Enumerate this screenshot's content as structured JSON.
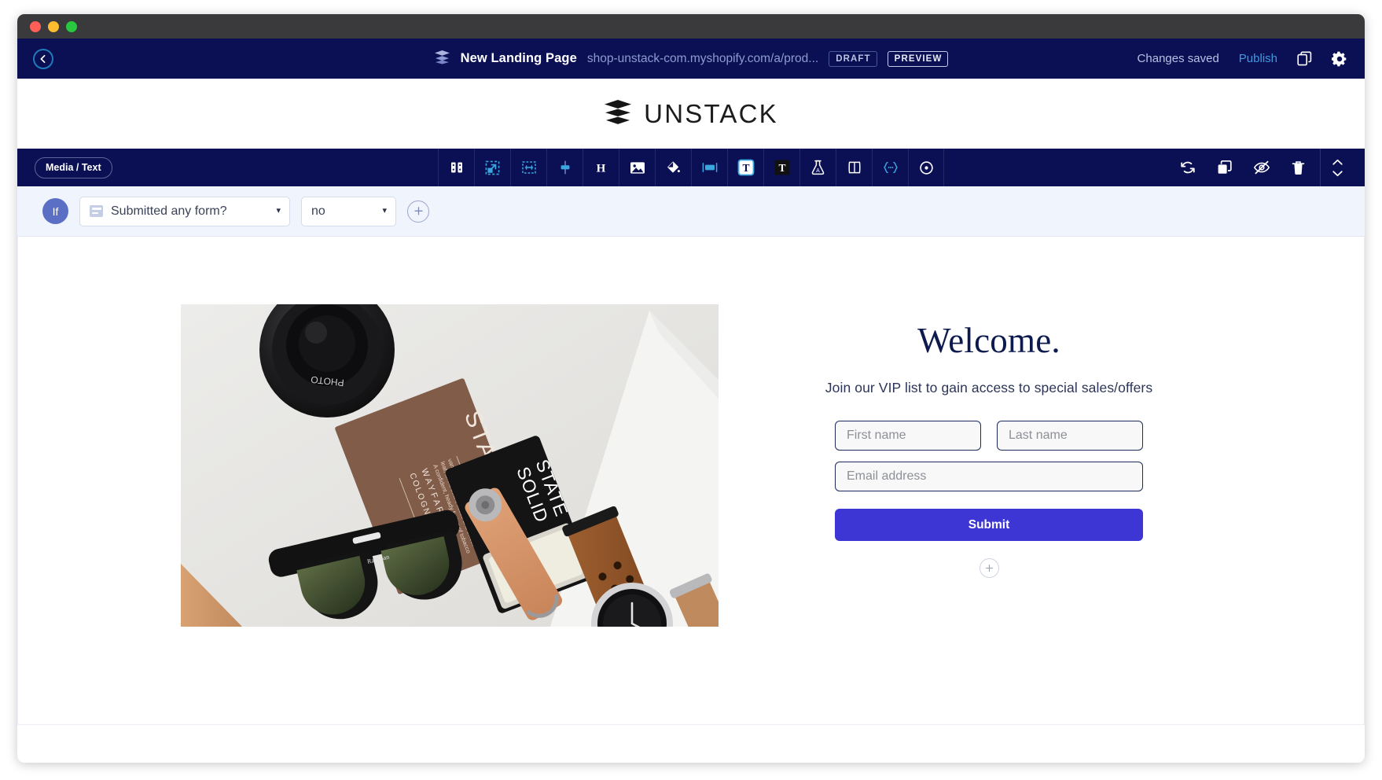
{
  "window": {
    "lights": [
      "close",
      "minimize",
      "zoom"
    ]
  },
  "appbar": {
    "back_icon": "chevron-left-icon",
    "brand_icon": "stack-layers-icon",
    "title": "New Landing Page",
    "url": "shop-unstack-com.myshopify.com/a/prod...",
    "status_badge": "DRAFT",
    "preview_badge": "PREVIEW",
    "save_status": "Changes saved",
    "publish_label": "Publish",
    "duplicate_icon": "copy-icon",
    "settings_icon": "gear-icon",
    "background": "#0b1054",
    "link_color": "#3f9ae0"
  },
  "brandbar": {
    "logo_icon": "stack-layers-icon",
    "wordmark": "UNSTACK"
  },
  "toolbar": {
    "block_chip": "Media / Text",
    "tools": [
      {
        "name": "layout-columns-icon",
        "glyph": "columns",
        "accent": false
      },
      {
        "name": "resize-section-icon",
        "glyph": "resize",
        "accent": true
      },
      {
        "name": "spacing-width-icon",
        "glyph": "width",
        "accent": true
      },
      {
        "name": "vertical-align-icon",
        "glyph": "valign",
        "accent": true
      },
      {
        "name": "heading-icon",
        "glyph": "H",
        "accent": false
      },
      {
        "name": "image-icon",
        "glyph": "image",
        "accent": false
      },
      {
        "name": "background-fill-icon",
        "glyph": "fill",
        "accent": false
      },
      {
        "name": "button-icon",
        "glyph": "button",
        "accent": true
      },
      {
        "name": "text-color-light-icon",
        "glyph": "T-light",
        "accent": false
      },
      {
        "name": "text-color-dark-icon",
        "glyph": "T-dark",
        "accent": false
      },
      {
        "name": "ab-test-icon",
        "glyph": "flask",
        "accent": false
      },
      {
        "name": "container-width-icon",
        "glyph": "container",
        "accent": false
      },
      {
        "name": "embed-code-icon",
        "glyph": "braces",
        "accent": true
      },
      {
        "name": "target-personalize-icon",
        "glyph": "target",
        "accent": false
      }
    ],
    "right_tools": [
      {
        "name": "refresh-icon"
      },
      {
        "name": "duplicate-block-icon"
      },
      {
        "name": "hide-block-icon"
      },
      {
        "name": "delete-block-icon"
      }
    ],
    "move_icon": "move-up-down-icon",
    "background": "#0b1054"
  },
  "condition_bar": {
    "if_label": "If",
    "condition_icon": "form-icon",
    "condition_value": "Submitted any form?",
    "answer_value": "no",
    "add_condition_icon": "plus-icon",
    "background": "#f0f4fd"
  },
  "canvas": {
    "media": {
      "name": "hero-image",
      "alt": "Flat lay of camera lens, Wayfarer cologne box, Solid State balm, leather watch straps and Ray-Ban sunglasses on a white surface"
    },
    "heading": "Welcome.",
    "subheading": "Join our VIP list to gain access to special sales/offers",
    "form": {
      "first_name_placeholder": "First name",
      "last_name_placeholder": "Last name",
      "email_placeholder": "Email address",
      "submit_label": "Submit",
      "submit_color": "#3d36d4"
    },
    "add_block_icon": "plus-icon"
  }
}
